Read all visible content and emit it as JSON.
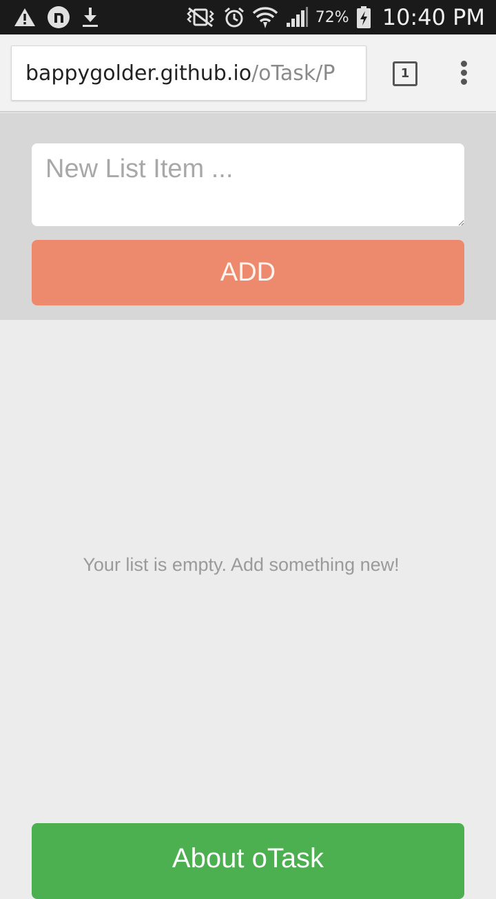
{
  "status_bar": {
    "icons_left": [
      "warning-icon",
      "n-notification-icon",
      "download-icon"
    ],
    "icons_right": [
      "vibrate-icon",
      "alarm-icon",
      "wifi-icon",
      "signal-icon",
      "battery-charging-icon"
    ],
    "battery_percent": "72%",
    "time": "10:40 PM"
  },
  "browser": {
    "url_host": "bappygolder.github.io",
    "url_path": "/oTask/P",
    "tab_count": "1",
    "menu_icon": "more-vert-icon"
  },
  "app": {
    "input_placeholder": "New List Item ...",
    "input_value": "",
    "add_label": "ADD",
    "empty_message": "Your list is empty. Add something new!",
    "about_label": "About oTask"
  },
  "colors": {
    "add_button": "#ed8a6e",
    "about_button": "#4caf50",
    "panel_bg": "#d7d7d7",
    "page_bg": "#ececec"
  }
}
